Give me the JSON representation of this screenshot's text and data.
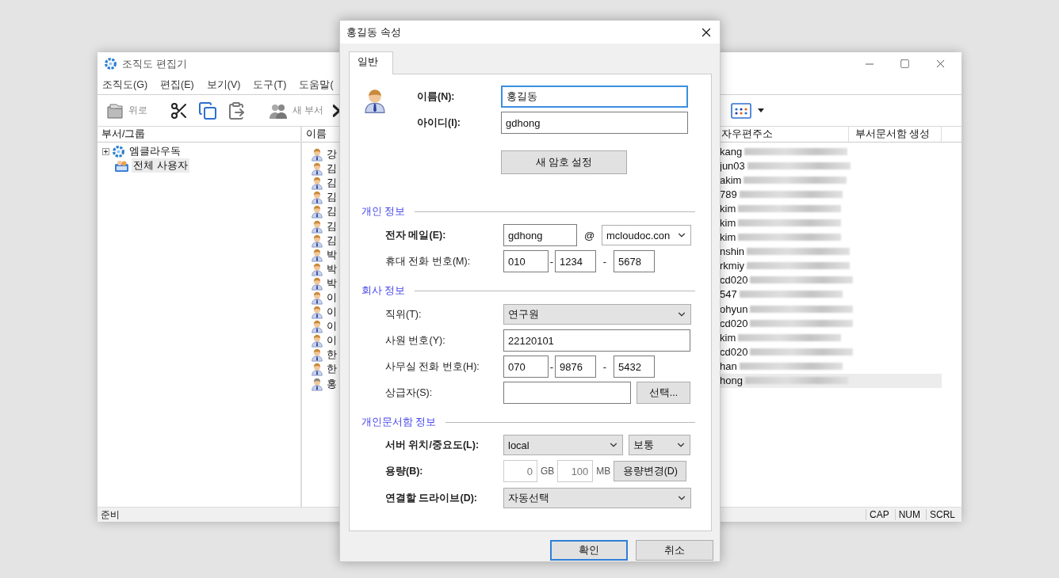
{
  "main_window": {
    "title": "조직도 편집기",
    "menu": [
      "조직도(G)",
      "편집(E)",
      "보기(V)",
      "도구(T)",
      "도움말("
    ],
    "toolbar_groups": [
      [
        {
          "kind": "up",
          "label": "위로"
        }
      ],
      [
        {
          "kind": "cut"
        },
        {
          "kind": "copy"
        },
        {
          "kind": "paste"
        }
      ],
      [
        {
          "kind": "new_dept",
          "label": "새 부서"
        },
        {
          "kind": "delete"
        }
      ]
    ],
    "view_button": {
      "kind": "grid"
    },
    "tree": {
      "header": "부서/그룹",
      "items": [
        {
          "label": "엠클라우독",
          "kind": "org",
          "expanded": false,
          "selected": false
        },
        {
          "label": "전체 사용자",
          "kind": "group",
          "selected": true
        }
      ]
    },
    "list": {
      "columns": [
        "이름",
        "자우편주소",
        "부서문서함 생성"
      ],
      "rows": [
        {
          "name": "강",
          "email": "kang",
          "kind": "user",
          "selected": false
        },
        {
          "name": "김",
          "email": "jun03",
          "kind": "user",
          "selected": false
        },
        {
          "name": "김",
          "email": "akim",
          "kind": "user",
          "selected": false
        },
        {
          "name": "김",
          "email": "789",
          "kind": "user",
          "selected": false
        },
        {
          "name": "김",
          "email": "kim",
          "kind": "user",
          "selected": false
        },
        {
          "name": "김",
          "email": "kim",
          "kind": "user",
          "selected": false
        },
        {
          "name": "김",
          "email": "kim",
          "kind": "user",
          "selected": false
        },
        {
          "name": "박",
          "email": "nshin",
          "kind": "user",
          "selected": false
        },
        {
          "name": "박",
          "email": "rkmiy",
          "kind": "user",
          "selected": false
        },
        {
          "name": "박",
          "email": "cd020",
          "kind": "user",
          "selected": false
        },
        {
          "name": "이",
          "email": "547",
          "kind": "user",
          "selected": false
        },
        {
          "name": "이",
          "email": "ohyun",
          "kind": "user",
          "selected": false
        },
        {
          "name": "이",
          "email": "cd020",
          "kind": "user",
          "selected": false
        },
        {
          "name": "이",
          "email": "kim",
          "kind": "user",
          "selected": false
        },
        {
          "name": "한",
          "email": "cd020",
          "kind": "user",
          "selected": false
        },
        {
          "name": "한",
          "email": "han",
          "kind": "user",
          "selected": false
        },
        {
          "name": "홍",
          "email": "hong",
          "kind": "current",
          "selected": true
        }
      ]
    },
    "status": {
      "text": "준비",
      "indicators": [
        "CAP",
        "NUM",
        "SCRL"
      ]
    }
  },
  "dialog": {
    "title": "홍길동 속성",
    "tabs": [
      {
        "label": "일반",
        "selected": true
      }
    ],
    "name": {
      "label": "이름(N):",
      "value": "홍길동",
      "focused": true
    },
    "id": {
      "label": "아이디(I):",
      "value": "gdhong",
      "focused": false
    },
    "password_button": "새 암호 설정",
    "sections": [
      {
        "title": "개인 정보",
        "rows": [
          {
            "kind": "email",
            "label": "전자 메일(E):",
            "bold": true,
            "user": "gdhong",
            "at": "@",
            "domain": "mcloudoc.con"
          },
          {
            "kind": "phone",
            "label": "휴대 전화 번호(M):",
            "bold": false,
            "parts": [
              "010",
              "1234",
              "5678"
            ],
            "separator": "-"
          }
        ]
      },
      {
        "title": "회사 정보",
        "rows": [
          {
            "kind": "select",
            "label": "직위(T):",
            "bold": false,
            "value": "연구원"
          },
          {
            "kind": "text",
            "label": "사원 번호(Y):",
            "bold": false,
            "value": "22120101"
          },
          {
            "kind": "phone",
            "label": "사무실 전화 번호(H):",
            "bold": false,
            "parts": [
              "070",
              "9876",
              "5432"
            ],
            "separator": "-"
          },
          {
            "kind": "text_button",
            "label": "상급자(S):",
            "bold": false,
            "button": "선택..."
          }
        ]
      },
      {
        "title": "개인문서함 정보",
        "rows": [
          {
            "kind": "two_selects",
            "label": "서버 위치/중요도(L):",
            "bold": true,
            "values": [
              "local",
              "보통"
            ]
          },
          {
            "kind": "capacity",
            "label": "용량(B):",
            "bold": true,
            "gb": "0",
            "gb_unit": "GB",
            "mb": "100",
            "mb_unit": "MB",
            "disabled": true,
            "button": "용량변경(D)"
          },
          {
            "kind": "select",
            "label": "연결할 드라이브(D):",
            "bold": true,
            "value": "자동선택"
          }
        ]
      }
    ],
    "buttons": [
      {
        "label": "확인",
        "default": true
      },
      {
        "label": "취소",
        "default": false
      }
    ]
  }
}
